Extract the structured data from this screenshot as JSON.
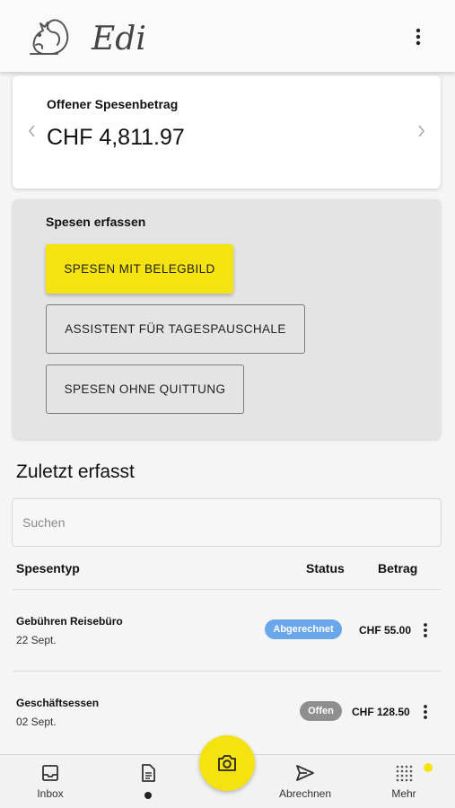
{
  "header": {
    "app_name": "Edi",
    "menu_icon": "kebab-vertical-icon"
  },
  "balance": {
    "title": "Offener Spesenbetrag",
    "amount": "CHF 4,811.97"
  },
  "capture": {
    "title": "Spesen erfassen",
    "primary_button": "SPESEN MIT BELEGBILD",
    "daily_allowance_button": "ASSISTENT FÜR TAGESPAUSCHALE",
    "no_receipt_button": "SPESEN OHNE QUITTUNG"
  },
  "recent": {
    "title": "Zuletzt erfasst",
    "search_placeholder": "Suchen",
    "columns": {
      "type": "Spesentyp",
      "status": "Status",
      "amount": "Betrag"
    },
    "rows": [
      {
        "type": "Gebühren Reisebüro",
        "date": "22 Sept.",
        "status": "Abgerechnet",
        "status_color": "#6aa6ea",
        "amount": "CHF 55.00"
      },
      {
        "type": "Geschäftsessen",
        "date": "02 Sept.",
        "status": "Offen",
        "status_color": "#8f8f8f",
        "amount": "CHF 128.50"
      }
    ]
  },
  "nav": {
    "inbox": "Inbox",
    "documents": "",
    "billing": "Abrechnen",
    "more": "Mehr"
  },
  "colors": {
    "accent_yellow": "#f5e211",
    "status_settled": "#6aa6ea",
    "status_open": "#8f8f8f"
  }
}
